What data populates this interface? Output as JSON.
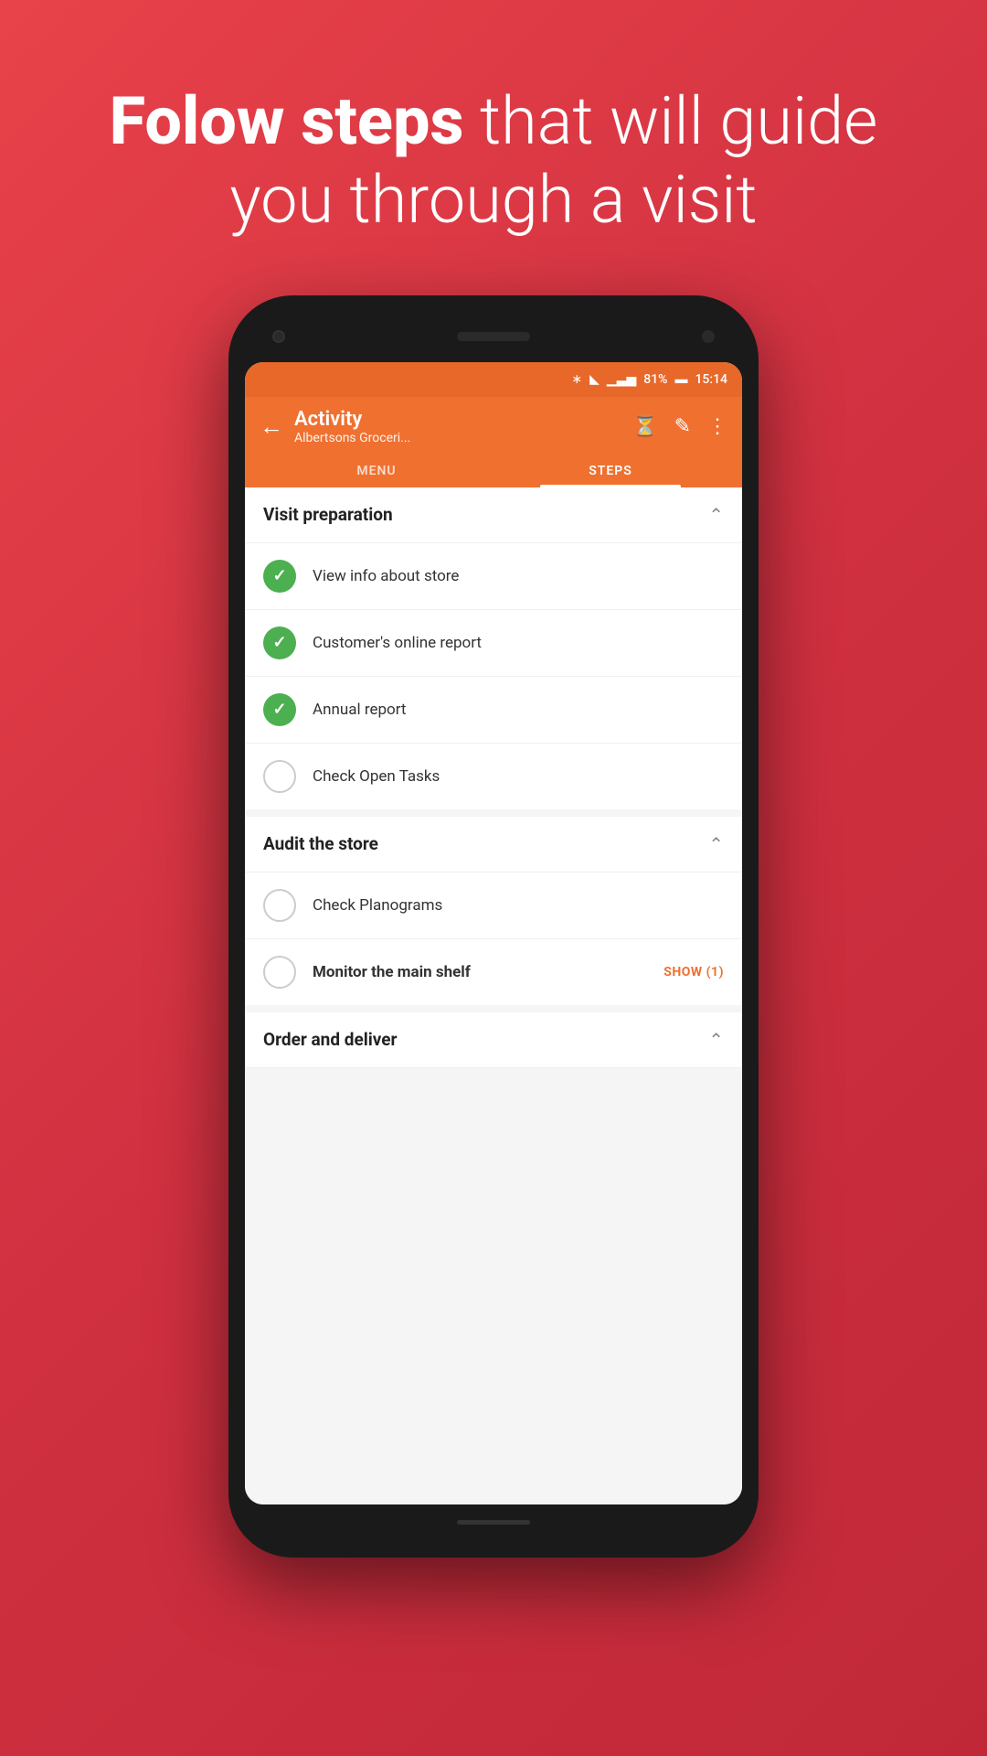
{
  "hero": {
    "bold_text": "Folow steps",
    "normal_text": " that will guide you through a visit"
  },
  "status_bar": {
    "battery": "81%",
    "time": "15:14",
    "icons": [
      "bluetooth",
      "wifi",
      "signal",
      "battery"
    ]
  },
  "app_bar": {
    "title": "Activity",
    "subtitle": "Albertsons Groceri...",
    "back_label": "←",
    "actions": [
      "history",
      "edit",
      "more"
    ]
  },
  "tabs": [
    {
      "label": "MENU",
      "active": false
    },
    {
      "label": "STEPS",
      "active": true
    }
  ],
  "sections": [
    {
      "id": "visit-preparation",
      "title": "Visit preparation",
      "expanded": true,
      "items": [
        {
          "label": "View info about store",
          "checked": true,
          "bold": false
        },
        {
          "label": "Customer's online report",
          "checked": true,
          "bold": false
        },
        {
          "label": "Annual report",
          "checked": true,
          "bold": false
        },
        {
          "label": "Check Open Tasks",
          "checked": false,
          "bold": false
        }
      ]
    },
    {
      "id": "audit-store",
      "title": "Audit the store",
      "expanded": true,
      "items": [
        {
          "label": "Check Planograms",
          "checked": false,
          "bold": false
        },
        {
          "label": "Monitor the main shelf",
          "checked": false,
          "bold": true,
          "badge": "SHOW (1)"
        }
      ]
    },
    {
      "id": "order-deliver",
      "title": "Order and deliver",
      "expanded": true,
      "items": []
    }
  ],
  "colors": {
    "orange": "#f07030",
    "green": "#4caf50",
    "background": "#e8424a"
  }
}
